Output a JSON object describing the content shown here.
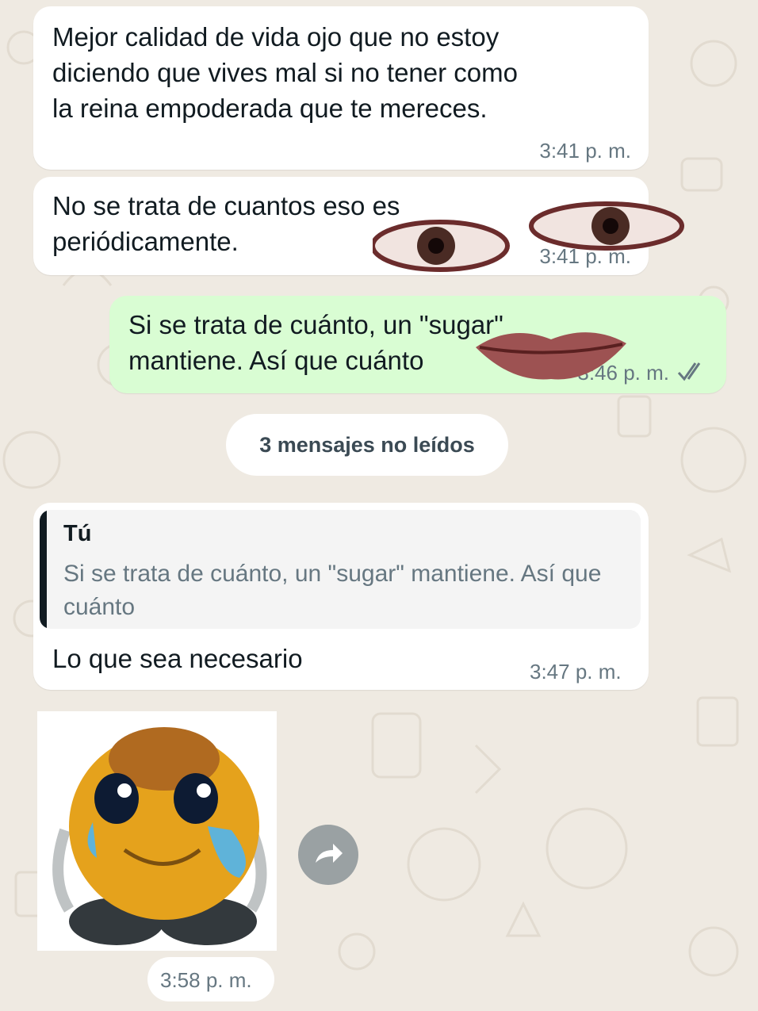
{
  "messages": [
    {
      "text": "Mejor calidad de vida ojo que no estoy\ndiciendo que vives mal si no tener como\nla reina empoderada que te mereces.",
      "time": "3:41 p. m."
    },
    {
      "text": "No se trata de cuantos eso es\nperiódicamente.",
      "time": "3:41 p. m."
    },
    {
      "text": "Si se trata de cuánto, un \"sugar\"\nmantiene. Así que cuánto",
      "time": "3:46 p. m."
    },
    {
      "text": "Lo que sea necesario",
      "time": "3:47 p. m."
    }
  ],
  "unread_separator": "3 mensajes no leídos",
  "reply": {
    "author": "Tú",
    "text": "Si se trata de cuánto, un \"sugar\" mantiene. Así que cuánto"
  },
  "sticker": {
    "description": "crying-emoji-sticker",
    "time": "3:58 p. m."
  },
  "icons": {
    "read_ticks": "double-check-icon",
    "forward": "forward-icon"
  },
  "colors": {
    "incoming": "#ffffff",
    "outgoing": "#d9fdd3",
    "background": "#efeae2",
    "meta": "#667781"
  }
}
